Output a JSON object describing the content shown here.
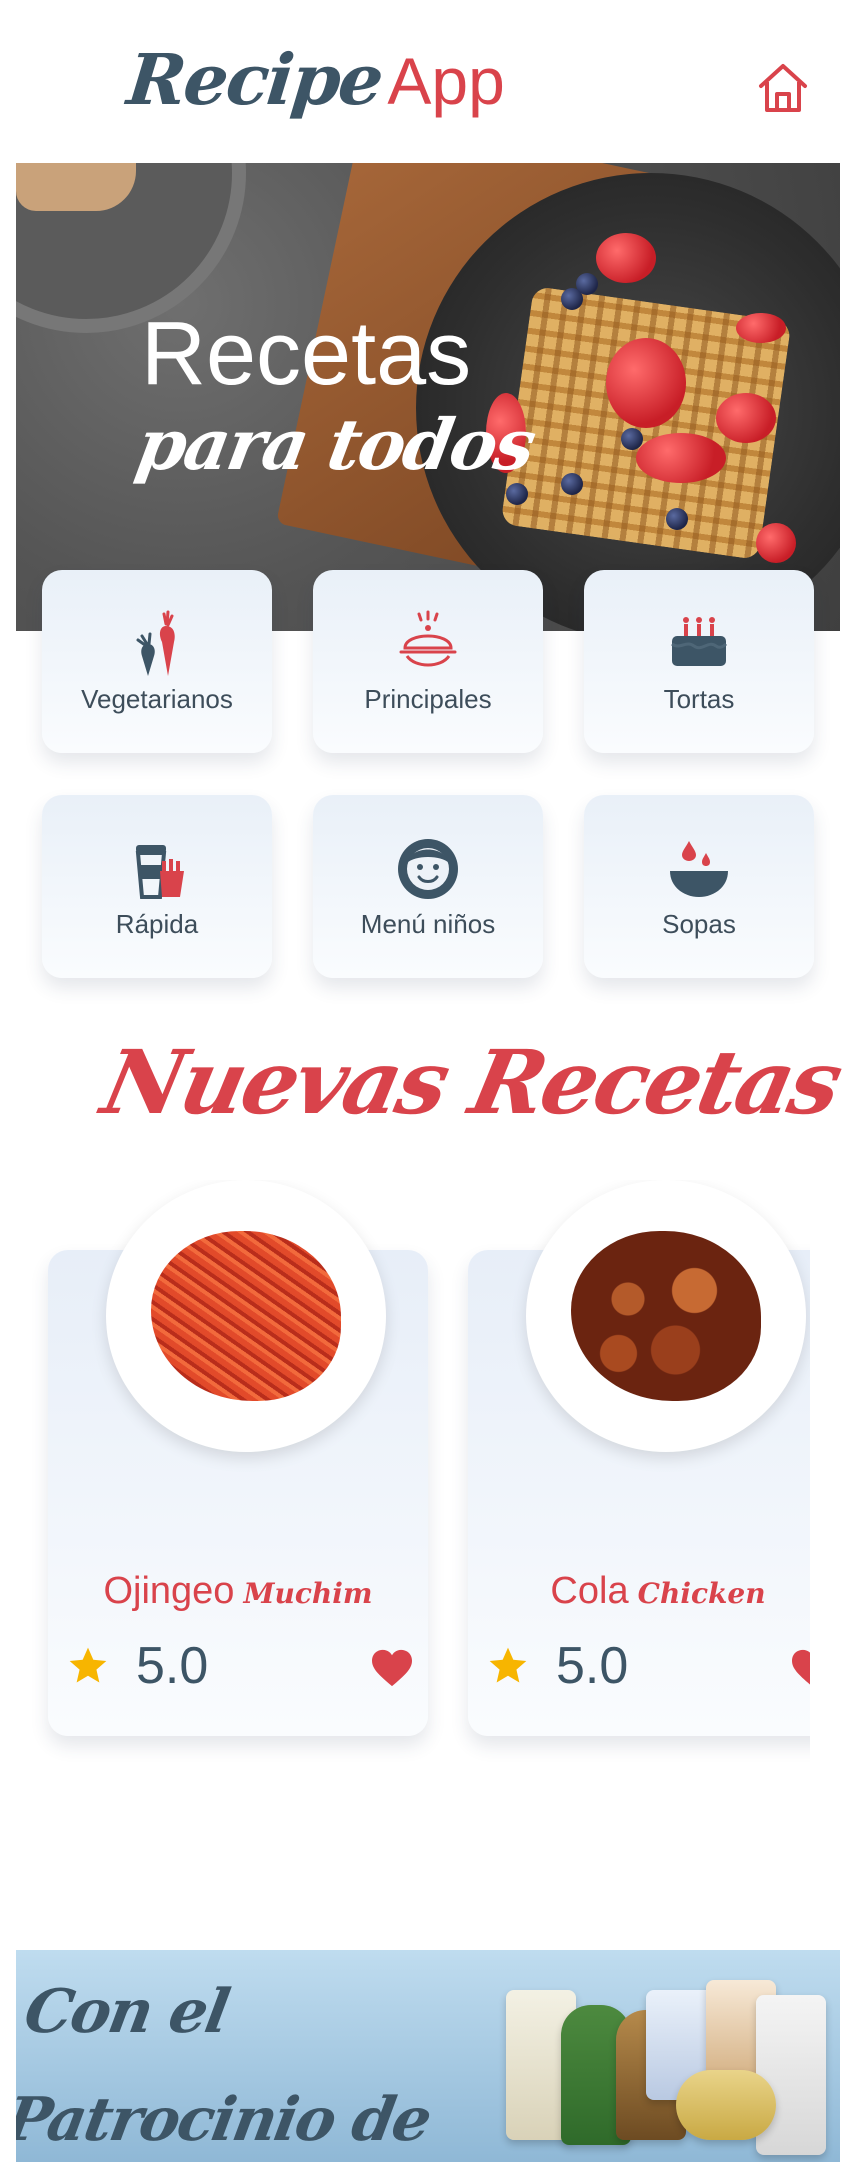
{
  "header": {
    "logo_script": "Recipe",
    "logo_app": "App",
    "home_icon": "home-icon"
  },
  "hero": {
    "title": "Recetas",
    "subtitle": "para todos"
  },
  "categories": [
    {
      "label": "Vegetarianos",
      "icon": "vegetables-icon"
    },
    {
      "label": "Principales",
      "icon": "serving-dish-icon"
    },
    {
      "label": "Tortas",
      "icon": "cake-icon"
    },
    {
      "label": "Rápida",
      "icon": "fast-food-icon"
    },
    {
      "label": "Menú niños",
      "icon": "child-face-icon"
    },
    {
      "label": "Sopas",
      "icon": "soup-bowl-icon"
    }
  ],
  "new_recipes": {
    "title": "Nuevas Recetas",
    "items": [
      {
        "name_main": "Ojingeo",
        "name_script": "Muchim",
        "rating": "5.0",
        "icon_star": "star-icon",
        "icon_fav": "heart-icon"
      },
      {
        "name_main": "Cola",
        "name_script": "Chicken",
        "rating": "5.0",
        "icon_star": "star-icon",
        "icon_fav": "heart-icon"
      }
    ]
  },
  "sponsor": {
    "text": "Con el Patrocinio de"
  },
  "colors": {
    "accent": "#d9434b",
    "primary_text": "#3d5566",
    "star": "#f7b500",
    "card_bg": "#eef3f9"
  }
}
